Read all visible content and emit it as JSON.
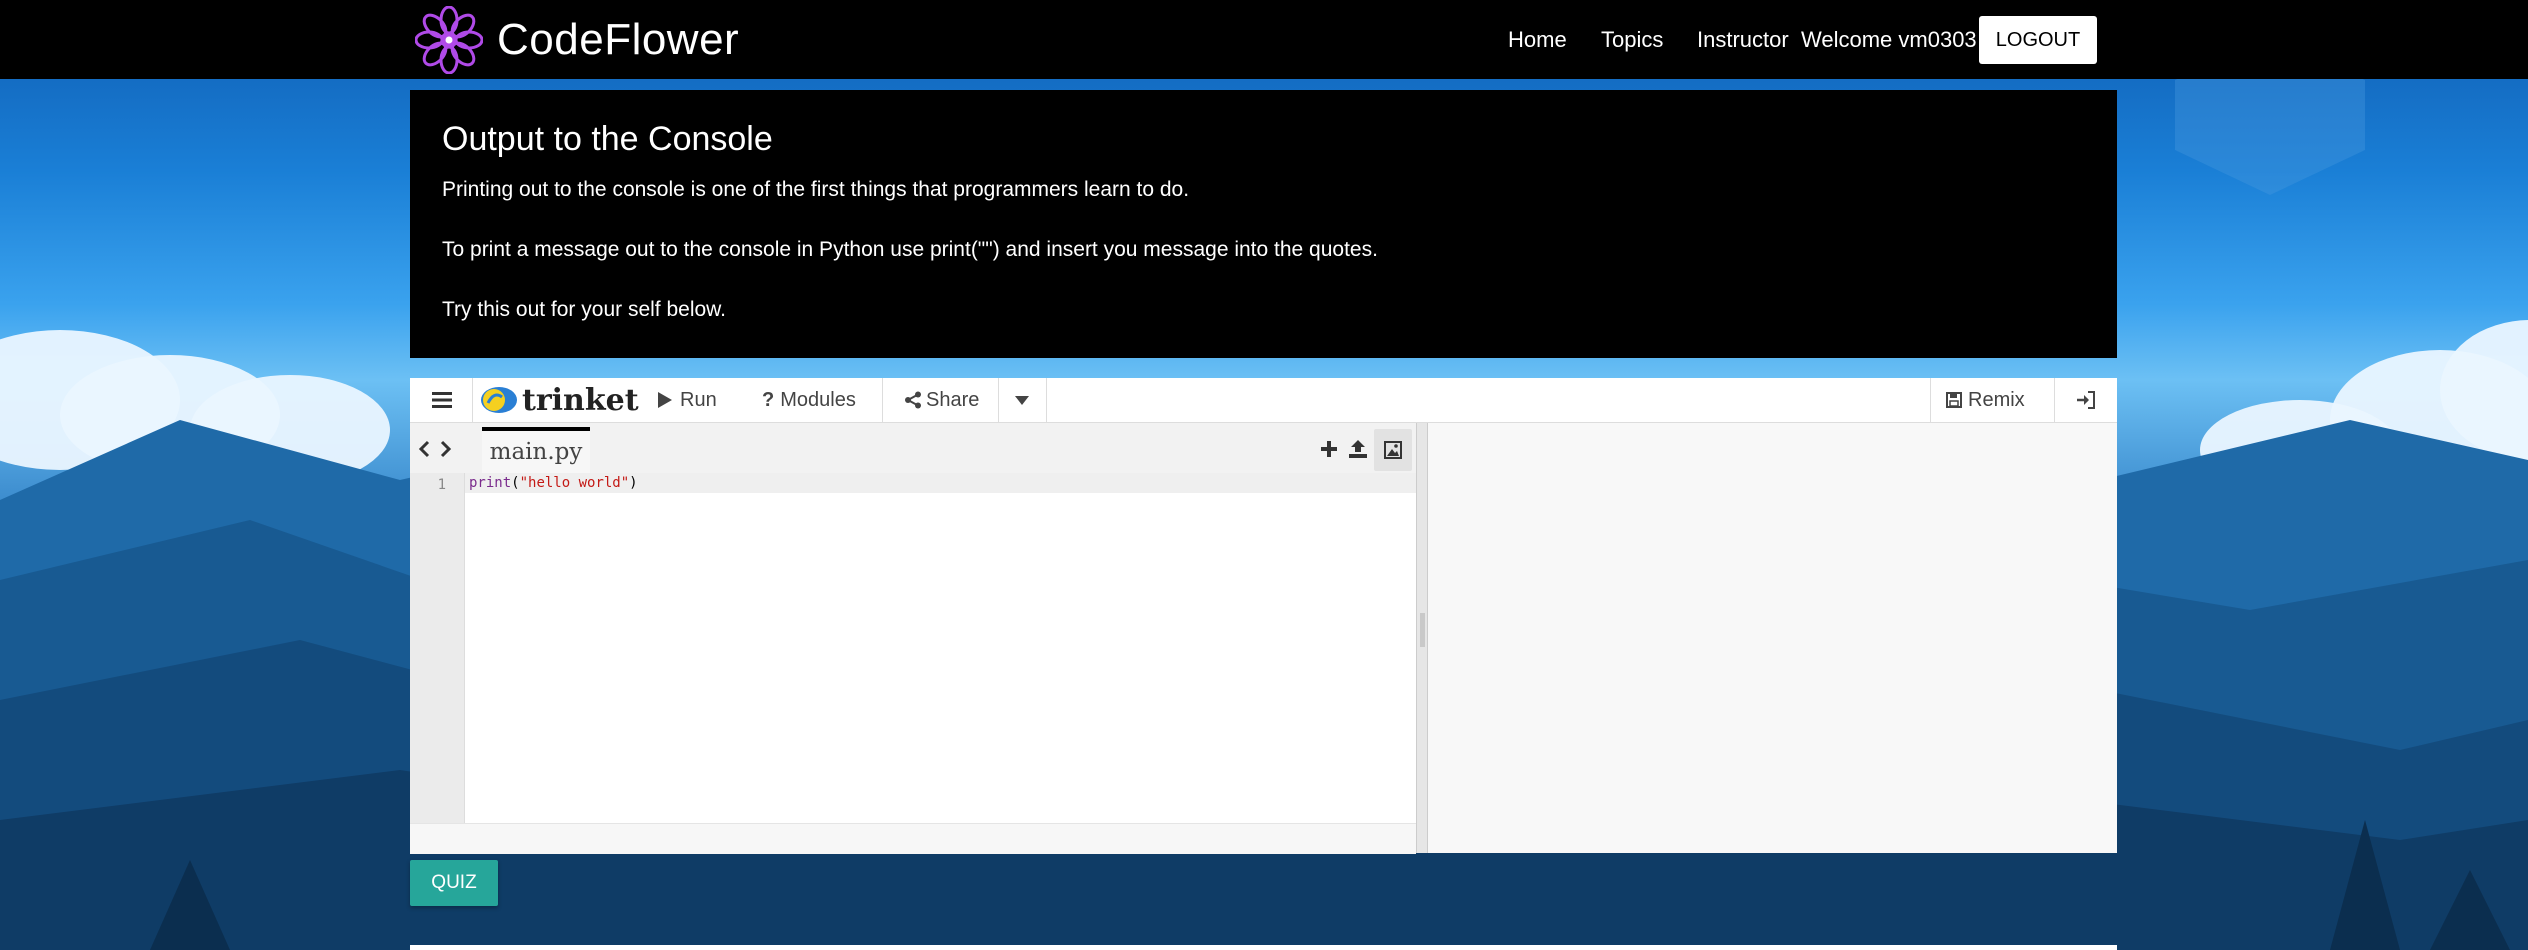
{
  "brand": {
    "name": "CodeFlower"
  },
  "nav": {
    "links": [
      "Home",
      "Topics",
      "Instructor"
    ],
    "welcome": "Welcome vm0303",
    "logout": "LOGOUT"
  },
  "lesson": {
    "title": "Output to the Console",
    "paragraphs": [
      "Printing out to the console is one of the first things that programmers learn to do.",
      "To print a message out to the console in Python use print(\"\") and insert you message into the quotes.",
      "Try this out for your self below."
    ]
  },
  "trinket": {
    "logo_text": "trinket",
    "run": "Run",
    "modules": "Modules",
    "share": "Share",
    "remix": "Remix",
    "file_tab": "main.py",
    "line_number": "1",
    "code": {
      "fn": "print",
      "open": "(",
      "str": "\"hello world\"",
      "close": ")"
    }
  },
  "quiz": {
    "label": "QUIZ"
  },
  "colors": {
    "accent": "#26a69a",
    "logo_purple": "#a020f0",
    "background_sky": "#1a7fd6"
  },
  "icons": [
    "flower-logo-icon",
    "hamburger-icon",
    "play-icon",
    "question-icon",
    "share-icon",
    "caret-down-icon",
    "save-icon",
    "sign-in-icon",
    "chevron-left-icon",
    "chevron-right-icon",
    "plus-icon",
    "upload-icon",
    "image-icon"
  ]
}
